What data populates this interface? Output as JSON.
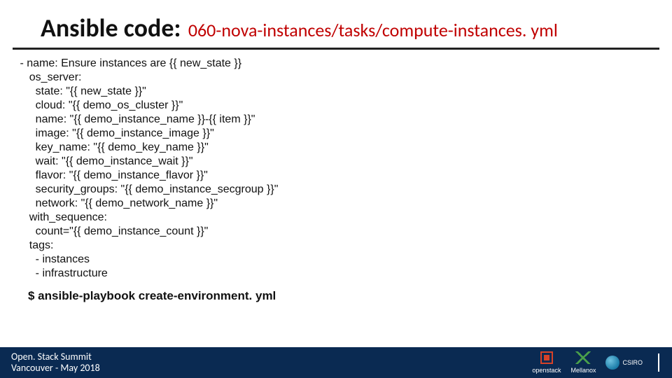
{
  "title": {
    "main": "Ansible code:",
    "sub": "060-nova-instances/tasks/compute-instances. yml"
  },
  "code": " - name: Ensure instances are {{ new_state }}\n    os_server:\n      state: \"{{ new_state }}\"\n      cloud: \"{{ demo_os_cluster }}\"\n      name: \"{{ demo_instance_name }}-{{ item }}\"\n      image: \"{{ demo_instance_image }}\"\n      key_name: \"{{ demo_key_name }}\"\n      wait: \"{{ demo_instance_wait }}\"\n      flavor: \"{{ demo_instance_flavor }}\"\n      security_groups: \"{{ demo_instance_secgroup }}\"\n      network: \"{{ demo_network_name }}\"\n    with_sequence:\n      count=\"{{ demo_instance_count }}\"\n    tags:\n      - instances\n      - infrastructure",
  "command": "$ ansible-playbook create-environment. yml",
  "footer": {
    "line1": "Open. Stack Summit",
    "line2": "Vancouver - May 2018",
    "logos": {
      "openstack": "openstack",
      "mellanox": "Mellanox",
      "csiro": "CSIRO"
    }
  }
}
